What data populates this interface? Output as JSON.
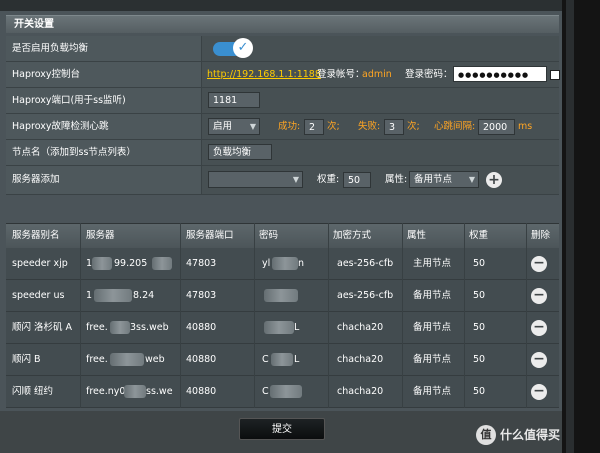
{
  "section_title": "开关设置",
  "form": {
    "load_balance": {
      "label": "是否启用负载均衡",
      "enabled": true,
      "check_glyph": "✓"
    },
    "console": {
      "label": "Haproxy控制台",
      "url": "http://192.168.1.1:1188",
      "account_label": "登录帐号：",
      "account_value": "admin",
      "password_label": "登录密码：",
      "password_mask": "●●●●●●●●●●"
    },
    "port": {
      "label": "Haproxy端口(用于ss监听)",
      "value": "1181"
    },
    "heartbeat": {
      "label": "Haproxy故障检测心跳",
      "select_value": "启用",
      "success_label": "成功:",
      "success_value": "2",
      "success_unit": "次;",
      "fail_label": "失败:",
      "fail_value": "3",
      "fail_unit": "次;",
      "interval_label": "心跳间隔:",
      "interval_value": "2000",
      "interval_unit": "ms"
    },
    "node_name": {
      "label": "节点名（添加到ss节点列表）",
      "value": "负载均衡"
    },
    "server_add": {
      "label": "服务器添加",
      "select_value": "",
      "weight_label": "权重:",
      "weight_value": "50",
      "attr_label": "属性:",
      "attr_value": "备用节点",
      "add_glyph": "+"
    }
  },
  "table": {
    "headers": [
      "服务器别名",
      "服务器",
      "服务器端口",
      "密码",
      "加密方式",
      "属性",
      "权重",
      "删除"
    ],
    "rows": [
      {
        "alias": "speeder xjp",
        "server_a": "1",
        "server_b": "99.205",
        "port": "47803",
        "password": "yl",
        "password_b": "n",
        "method": "aes-256-cfb",
        "attr": "主用节点",
        "weight": "50"
      },
      {
        "alias": "speeder us",
        "server_a": "1",
        "server_b": "8.24",
        "port": "47803",
        "password": "",
        "password_b": "",
        "method": "aes-256-cfb",
        "attr": "备用节点",
        "weight": "50"
      },
      {
        "alias": "顺闪 洛杉矶 A",
        "server_a": "free.",
        "server_b": "3ss.web",
        "port": "40880",
        "password": "",
        "password_b": "L",
        "method": "chacha20",
        "attr": "备用节点",
        "weight": "50"
      },
      {
        "alias": "顺闪 B",
        "server_a": "free.",
        "server_b": "web",
        "port": "40880",
        "password": "C",
        "password_b": "L",
        "method": "chacha20",
        "attr": "备用节点",
        "weight": "50"
      },
      {
        "alias": "闪顺 纽约",
        "server_a": "free.ny0",
        "server_b": "ss.we",
        "port": "40880",
        "password": "C",
        "password_b": "",
        "method": "chacha20",
        "attr": "备用节点",
        "weight": "50"
      }
    ],
    "delete_glyph": "−"
  },
  "submit_label": "提交",
  "watermark": {
    "logo_glyph": "值",
    "text": "什么值得买"
  }
}
